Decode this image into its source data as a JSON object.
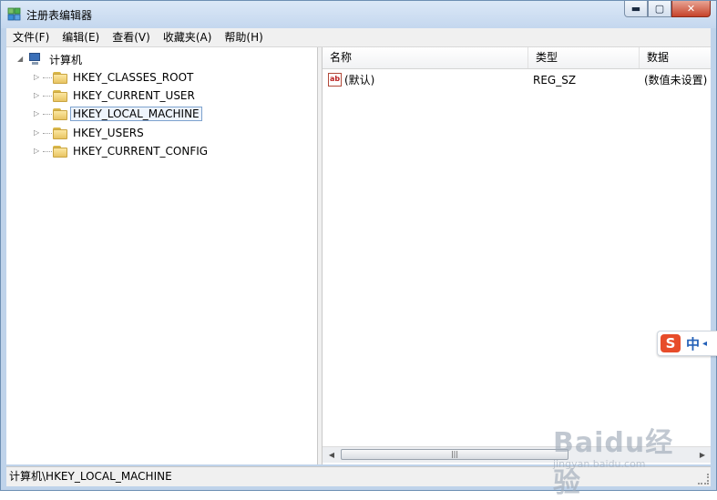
{
  "window": {
    "title": "注册表编辑器"
  },
  "caption": {
    "minimize": "▬",
    "maximize": "▢",
    "close": "✕"
  },
  "menu": [
    {
      "label": "文件(F)"
    },
    {
      "label": "编辑(E)"
    },
    {
      "label": "查看(V)"
    },
    {
      "label": "收藏夹(A)"
    },
    {
      "label": "帮助(H)"
    }
  ],
  "tree": {
    "root_label": "计算机",
    "items": [
      {
        "label": "HKEY_CLASSES_ROOT"
      },
      {
        "label": "HKEY_CURRENT_USER"
      },
      {
        "label": "HKEY_LOCAL_MACHINE",
        "selected": true
      },
      {
        "label": "HKEY_USERS"
      },
      {
        "label": "HKEY_CURRENT_CONFIG"
      }
    ]
  },
  "list": {
    "columns": [
      {
        "label": "名称"
      },
      {
        "label": "类型"
      },
      {
        "label": "数据"
      }
    ],
    "rows": [
      {
        "name": "(默认)",
        "type": "REG_SZ",
        "data": "(数值未设置)",
        "icon": "ab-string-value-icon"
      }
    ]
  },
  "status": {
    "path": "计算机\\HKEY_LOCAL_MACHINE"
  },
  "ime": {
    "logo": "S",
    "mode": "中"
  },
  "watermark": {
    "brand": "Baidu经验",
    "url": "jingyan.baidu.com"
  },
  "icons": {
    "ab_icon_text": "ab",
    "expand": "▷",
    "collapse": "◢",
    "scroll_left": "◀",
    "scroll_right": "▶",
    "scroll_grip": "|||"
  },
  "colors": {
    "title_bg": "#c4d7ee",
    "selection_border": "#7da2ce",
    "close_button": "#c6432a"
  }
}
